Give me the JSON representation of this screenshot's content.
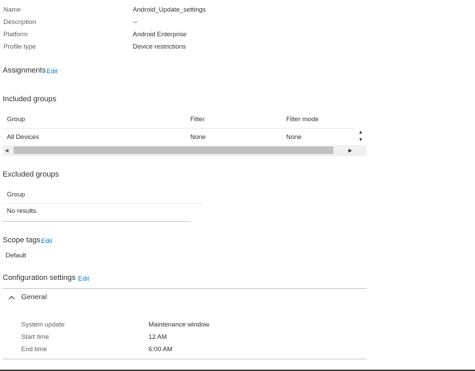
{
  "properties": [
    {
      "label": "Name",
      "value": "Android_Update_settings"
    },
    {
      "label": "Description",
      "value": "--"
    },
    {
      "label": "Platform",
      "value": "Android Enterprise"
    },
    {
      "label": "Profile type",
      "value": "Device restrictions"
    }
  ],
  "assignments": {
    "title": "Assignments",
    "edit": "Edit"
  },
  "included": {
    "title": "Included groups",
    "columns": [
      "Group",
      "Filter",
      "Filter mode"
    ],
    "rows": [
      [
        "All Devices",
        "None",
        "None"
      ]
    ]
  },
  "excluded": {
    "title": "Excluded groups",
    "column": "Group",
    "empty": "No results."
  },
  "scope": {
    "title": "Scope tags",
    "edit": "Edit",
    "value": "Default"
  },
  "config": {
    "title": "Configuration settings",
    "edit": "Edit",
    "section": "General",
    "settings": [
      {
        "label": "System update",
        "value": "Maintenance window"
      },
      {
        "label": "Start time",
        "value": "12 AM"
      },
      {
        "label": "End time",
        "value": "6:00 AM"
      }
    ]
  }
}
